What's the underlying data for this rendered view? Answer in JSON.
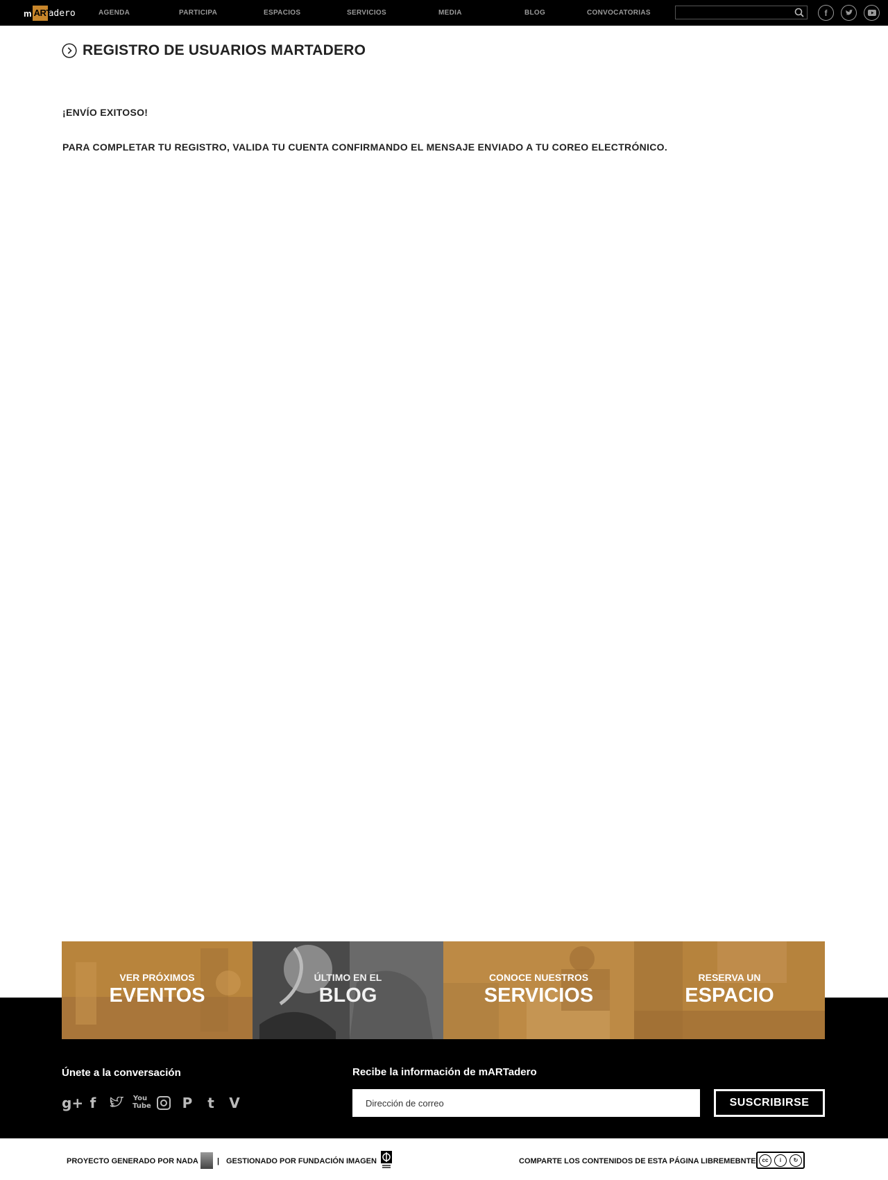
{
  "colors": {
    "accent": "#c8862b",
    "topbar": "#000000",
    "footer": "#000000"
  },
  "logo": {
    "box_text": "ART",
    "m": "m",
    "rest": "adero"
  },
  "nav": [
    "AGENDA",
    "PARTICIPA",
    "ESPACIOS",
    "SERVICIOS",
    "MEDIA",
    "BLOG",
    "CONVOCATORIAS"
  ],
  "search": {
    "placeholder": ""
  },
  "social_top": [
    "facebook-icon",
    "twitter-icon",
    "youtube-icon"
  ],
  "main": {
    "title": "REGISTRO DE USUARIOS MARTADERO",
    "success": "¡ENVÍO EXITOSO!",
    "instructions": "PARA COMPLETAR TU REGISTRO, VALIDA TU CUENTA CONFIRMANDO EL MENSAJE ENVIADO A TU COREO ELECTRÓNICO."
  },
  "tiles": [
    {
      "small": "VER PRÓXIMOS",
      "big": "EVENTOS"
    },
    {
      "small": "ÚLTIMO EN EL",
      "big": "BLOG"
    },
    {
      "small": "CONOCE NUESTROS",
      "big": "SERVICIOS"
    },
    {
      "small": "RESERVA UN",
      "big": "ESPACIO"
    }
  ],
  "footer": {
    "join_title": "Únete a la conversación",
    "social": [
      "google-plus-icon",
      "facebook-icon",
      "twitter-icon",
      "youtube-icon",
      "instagram-icon",
      "pinterest-icon",
      "tumblr-icon",
      "vine-icon"
    ],
    "news_title": "Recibe la información de mARTadero",
    "email_placeholder": "Dirección de correo",
    "subscribe": "SUSCRIBIRSE"
  },
  "bottom": {
    "generated": "PROYECTO GENERADO POR NADA",
    "separator": "|",
    "managed": "GESTIONADO POR FUNDACIÓN IMAGEN",
    "share": "COMPARTE LOS CONTENIDOS DE ESTA PÁGINA LIBREMEBNTE"
  }
}
